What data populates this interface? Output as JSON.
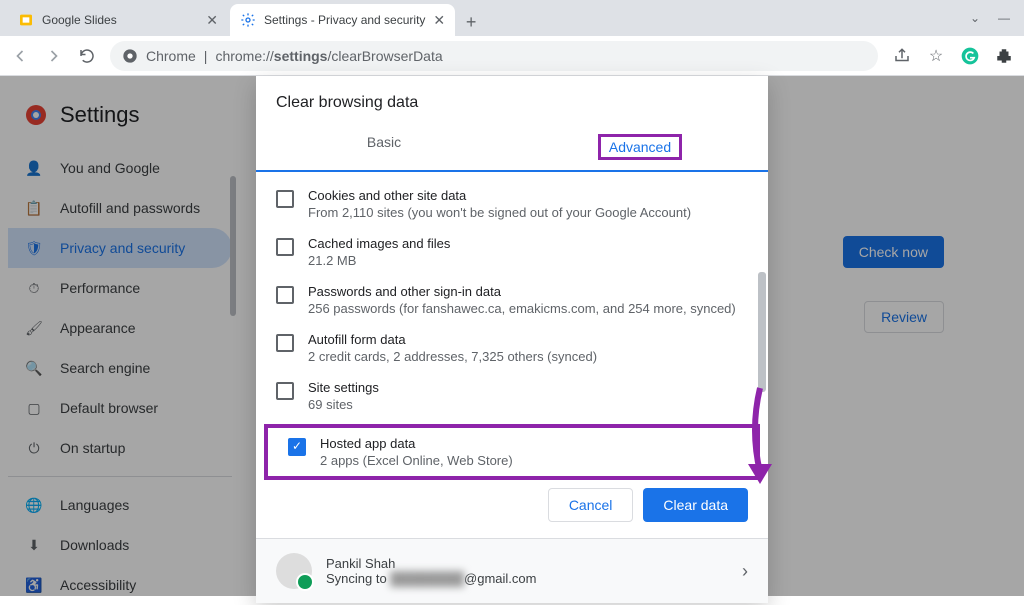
{
  "tabs": [
    {
      "title": "Google Slides"
    },
    {
      "title": "Settings - Privacy and security"
    }
  ],
  "omnibox": {
    "prefix": "Chrome",
    "separator": "|",
    "url_pre": "chrome://",
    "url_bold": "settings",
    "url_rest": "/clearBrowserData"
  },
  "settings_title": "Settings",
  "sidebar": {
    "items": [
      {
        "label": "You and Google"
      },
      {
        "label": "Autofill and passwords"
      },
      {
        "label": "Privacy and security"
      },
      {
        "label": "Performance"
      },
      {
        "label": "Appearance"
      },
      {
        "label": "Search engine"
      },
      {
        "label": "Default browser"
      },
      {
        "label": "On startup"
      }
    ],
    "items2": [
      {
        "label": "Languages"
      },
      {
        "label": "Downloads"
      },
      {
        "label": "Accessibility"
      }
    ]
  },
  "buttons_bg": {
    "check_now": "Check now",
    "review": "Review"
  },
  "dialog": {
    "title": "Clear browsing data",
    "tab_basic": "Basic",
    "tab_advanced": "Advanced",
    "options": [
      {
        "title": "Cookies and other site data",
        "sub": "From 2,110 sites (you won't be signed out of your Google Account)",
        "checked": false
      },
      {
        "title": "Cached images and files",
        "sub": "21.2 MB",
        "checked": false
      },
      {
        "title": "Passwords and other sign-in data",
        "sub": "256 passwords (for fanshawec.ca, emakicms.com, and 254 more, synced)",
        "checked": false
      },
      {
        "title": "Autofill form data",
        "sub": "2 credit cards, 2 addresses, 7,325 others (synced)",
        "checked": false
      },
      {
        "title": "Site settings",
        "sub": "69 sites",
        "checked": false
      },
      {
        "title": "Hosted app data",
        "sub": "2 apps (Excel Online, Web Store)",
        "checked": true
      }
    ],
    "cancel": "Cancel",
    "clear": "Clear data",
    "account": {
      "name": "Pankil Shah",
      "syncing_pre": "Syncing to ",
      "syncing_post": "@gmail.com"
    }
  }
}
